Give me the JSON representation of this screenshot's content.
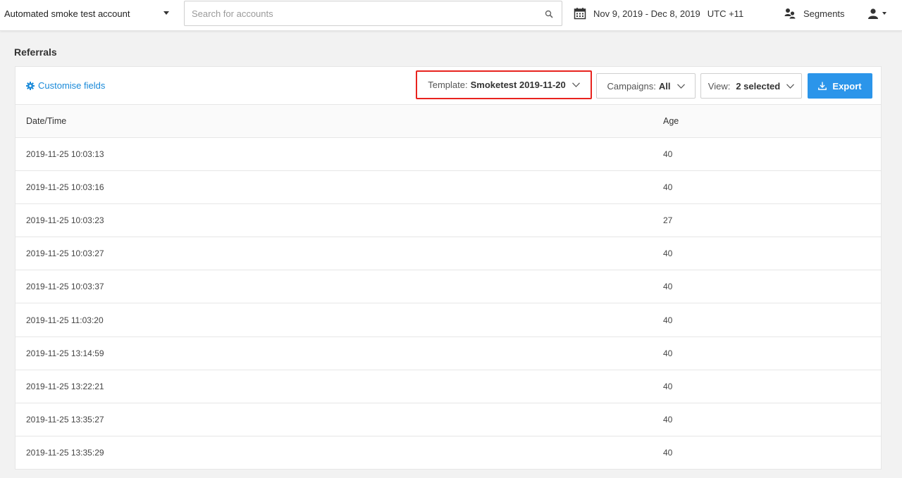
{
  "topbar": {
    "account_name": "Automated smoke test account",
    "search_placeholder": "Search for accounts",
    "search_value": "",
    "date_range": "Nov 9, 2019 - Dec 8, 2019",
    "timezone": "UTC +11",
    "segments_label": "Segments"
  },
  "page": {
    "title": "Referrals"
  },
  "toolbar": {
    "customise_label": "Customise fields",
    "template_label": "Template:",
    "template_value": "Smoketest 2019-11-20",
    "campaigns_label": "Campaigns:",
    "campaigns_value": "All",
    "view_label": "View:",
    "view_value": "2 selected",
    "export_label": "Export"
  },
  "colors": {
    "accent": "#2b95ea",
    "link": "#1a8ad9",
    "highlight": "#e8231e"
  },
  "table": {
    "headers": [
      "Date/Time",
      "Age"
    ],
    "rows": [
      [
        "2019-11-25 10:03:13",
        "40"
      ],
      [
        "2019-11-25 10:03:16",
        "40"
      ],
      [
        "2019-11-25 10:03:23",
        "27"
      ],
      [
        "2019-11-25 10:03:27",
        "40"
      ],
      [
        "2019-11-25 10:03:37",
        "40"
      ],
      [
        "2019-11-25 11:03:20",
        "40"
      ],
      [
        "2019-11-25 13:14:59",
        "40"
      ],
      [
        "2019-11-25 13:22:21",
        "40"
      ],
      [
        "2019-11-25 13:35:27",
        "40"
      ],
      [
        "2019-11-25 13:35:29",
        "40"
      ]
    ]
  }
}
